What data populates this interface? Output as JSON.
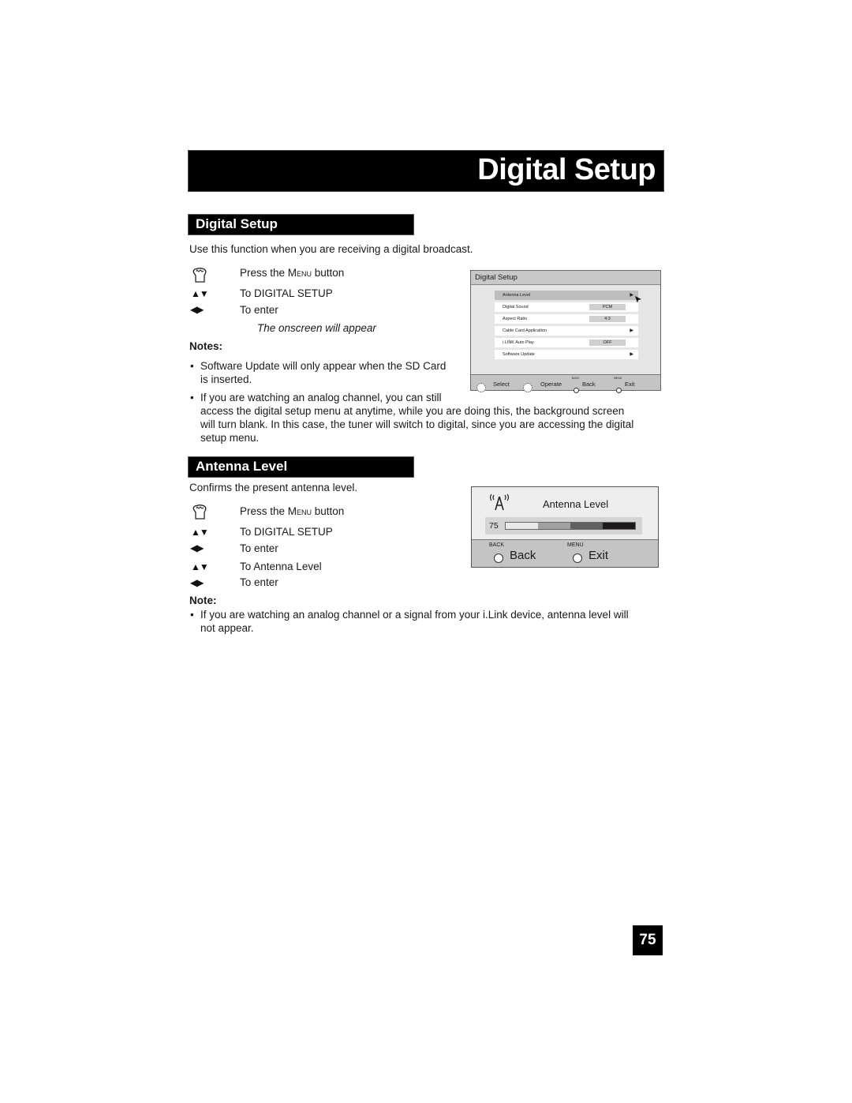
{
  "page_title": "Digital Setup",
  "page_number": "75",
  "section1": {
    "heading": "Digital Setup",
    "intro": "Use this function when you are receiving a digital broadcast.",
    "steps": [
      {
        "icon": "hand-press-icon",
        "pre": "Press the ",
        "sc": "Menu",
        "post": " button"
      },
      {
        "icon": "up-down-arrows-icon",
        "text": "To DIGITAL SETUP"
      },
      {
        "icon": "left-right-arrows-icon",
        "text": "To enter"
      }
    ],
    "caption": "The onscreen will appear",
    "notes_heading": "Notes:",
    "notes": [
      "Software Update will only appear when the SD Card",
      "is inserted.",
      "If you are watching an analog channel, you can still",
      "access the digital setup menu at anytime, while you are doing this, the background screen",
      "will turn blank.  In this case, the tuner will switch to digital, since you are accessing the digital",
      "setup menu."
    ]
  },
  "osd_menu": {
    "title": "Digital Setup",
    "items": [
      {
        "label": "Antenna Level",
        "value": null,
        "arrow": "▶",
        "selected": true
      },
      {
        "label": "Digital Sound",
        "value": "PCM"
      },
      {
        "label": "Aspect Ratio",
        "value": "4:3"
      },
      {
        "label": "Cable Card Application",
        "value": null,
        "arrow": "▶"
      },
      {
        "label": "i.LINK Auto Play",
        "value": "OFF"
      },
      {
        "label": "Software Update",
        "value": null,
        "arrow": "▶"
      }
    ],
    "footer": {
      "select": "Select",
      "operate": "Operate",
      "back_small": "BACK",
      "back": "Back",
      "menu_small": "MENU",
      "exit": "Exit"
    }
  },
  "section2": {
    "heading": "Antenna Level",
    "intro": "Confirms the present antenna level.",
    "steps": [
      {
        "icon": "hand-press-icon",
        "pre": "Press the ",
        "sc": "Menu",
        "post": " button"
      },
      {
        "icon": "up-down-arrows-icon",
        "text": "To DIGITAL SETUP"
      },
      {
        "icon": "left-right-arrows-icon",
        "text": "To enter"
      },
      {
        "icon": "up-down-arrows-icon",
        "text": "To Antenna Level"
      },
      {
        "icon": "left-right-arrows-icon",
        "text": "To enter"
      }
    ],
    "note_heading": "Note:",
    "note_lines": [
      "If you are watching an analog channel or a signal from your i.Link device, antenna level will",
      "not appear."
    ]
  },
  "osd_antenna": {
    "title": "Antenna Level",
    "level": "75",
    "level_fraction": 0.75,
    "segment_colors": [
      "#e8e8e8",
      "#a0a0a0",
      "#606060",
      "#1e1a1a"
    ],
    "back_small": "BACK",
    "back": "Back",
    "menu_small": "MENU",
    "exit": "Exit"
  }
}
